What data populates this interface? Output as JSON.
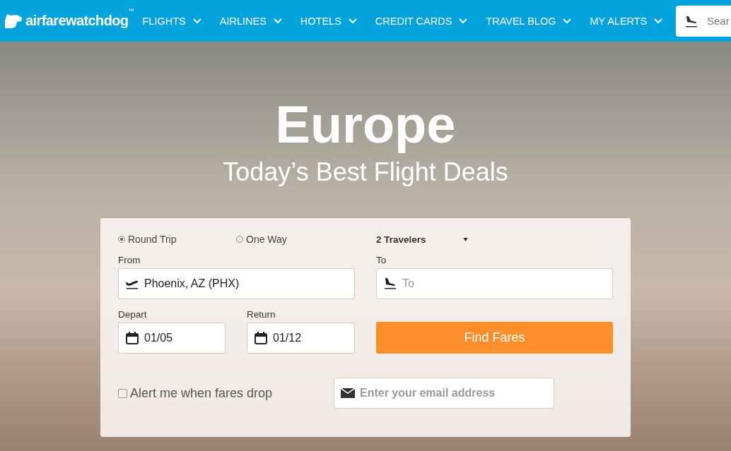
{
  "header": {
    "logo": {
      "name": "airfarewatchdog",
      "trademark": "™"
    },
    "nav": [
      {
        "label": "FLIGHTS"
      },
      {
        "label": "AIRLINES"
      },
      {
        "label": "HOTELS"
      },
      {
        "label": "CREDIT CARDS"
      },
      {
        "label": "TRAVEL BLOG"
      },
      {
        "label": "MY ALERTS"
      }
    ],
    "search": {
      "placeholder": "Sear"
    }
  },
  "hero": {
    "title": "Europe",
    "subtitle": "Today’s Best Flight Deals"
  },
  "form": {
    "trip_types": [
      {
        "label": "Round Trip",
        "selected": true
      },
      {
        "label": "One Way",
        "selected": false
      }
    ],
    "travelers": "2 Travelers",
    "from": {
      "label": "From",
      "value": "Phoenix, AZ (PHX)"
    },
    "to": {
      "label": "To",
      "placeholder": "To"
    },
    "depart": {
      "label": "Depart",
      "value": "01/05"
    },
    "return": {
      "label": "Return",
      "value": "01/12"
    },
    "submit": "Find Fares",
    "alert": {
      "label": "Alert me when fares drop",
      "checked": false
    },
    "email": {
      "placeholder": "Enter your email address"
    }
  }
}
